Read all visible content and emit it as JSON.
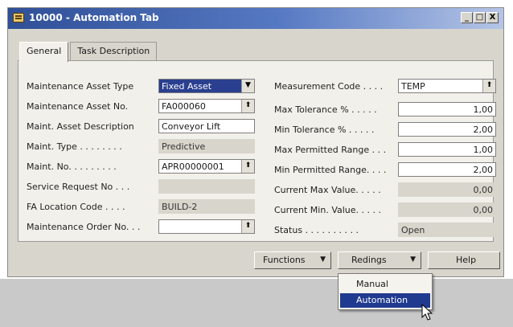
{
  "window": {
    "title": "10000 - Automation Tab",
    "controls": {
      "minimize": "_",
      "restore": "□",
      "close": "X"
    }
  },
  "tabs": [
    {
      "label": "General",
      "active": true
    },
    {
      "label": "Task Description",
      "active": false
    }
  ],
  "left_fields": [
    {
      "label": "Maintenance Asset Type",
      "value": "Fixed Asset",
      "kind": "dropdown-selected"
    },
    {
      "label": "Maintenance Asset No.",
      "value": "FA000060",
      "kind": "lookup"
    },
    {
      "label": "Maint. Asset Description",
      "value": "Conveyor Lift",
      "kind": "text"
    },
    {
      "label": "Maint. Type . . . . . . . .",
      "value": "Predictive",
      "kind": "readonly"
    },
    {
      "label": "Maint. No. . . . . . . . .",
      "value": "APR00000001",
      "kind": "lookup"
    },
    {
      "label": "Service Request No . . .",
      "value": "",
      "kind": "readonly"
    },
    {
      "label": "FA Location Code . . . .",
      "value": "BUILD-2",
      "kind": "readonly"
    },
    {
      "label": "Maintenance Order No. . .",
      "value": "",
      "kind": "lookup"
    }
  ],
  "right_fields": [
    {
      "label": "Measurement Code . . . .",
      "value": "TEMP",
      "kind": "lookup"
    },
    {
      "label": "Max Tolerance % . . . . .",
      "value": "1,00",
      "kind": "number"
    },
    {
      "label": "Min Tolerance % . . . . .",
      "value": "2,00",
      "kind": "number"
    },
    {
      "label": "Max Permitted Range . . .",
      "value": "1,00",
      "kind": "number"
    },
    {
      "label": "Min Permitted Range. . . .",
      "value": "2,00",
      "kind": "number"
    },
    {
      "label": "Current Max Value. . . . .",
      "value": "0,00",
      "kind": "readonly-number"
    },
    {
      "label": "Current Min. Value. . . . .",
      "value": "0,00",
      "kind": "readonly-number"
    },
    {
      "label": "Status . . . . . . . . . .",
      "value": "Open",
      "kind": "readonly"
    }
  ],
  "buttons": {
    "functions": "Functions",
    "readings": "Redings",
    "help": "Help"
  },
  "readings_menu": {
    "items": [
      {
        "label": "Manual",
        "highlighted": false
      },
      {
        "label": "Automation",
        "highlighted": true
      }
    ]
  },
  "colors": {
    "title_bar_start": "#2f4f97",
    "selection": "#1f3a8f",
    "window_bg": "#d8d5cc"
  }
}
